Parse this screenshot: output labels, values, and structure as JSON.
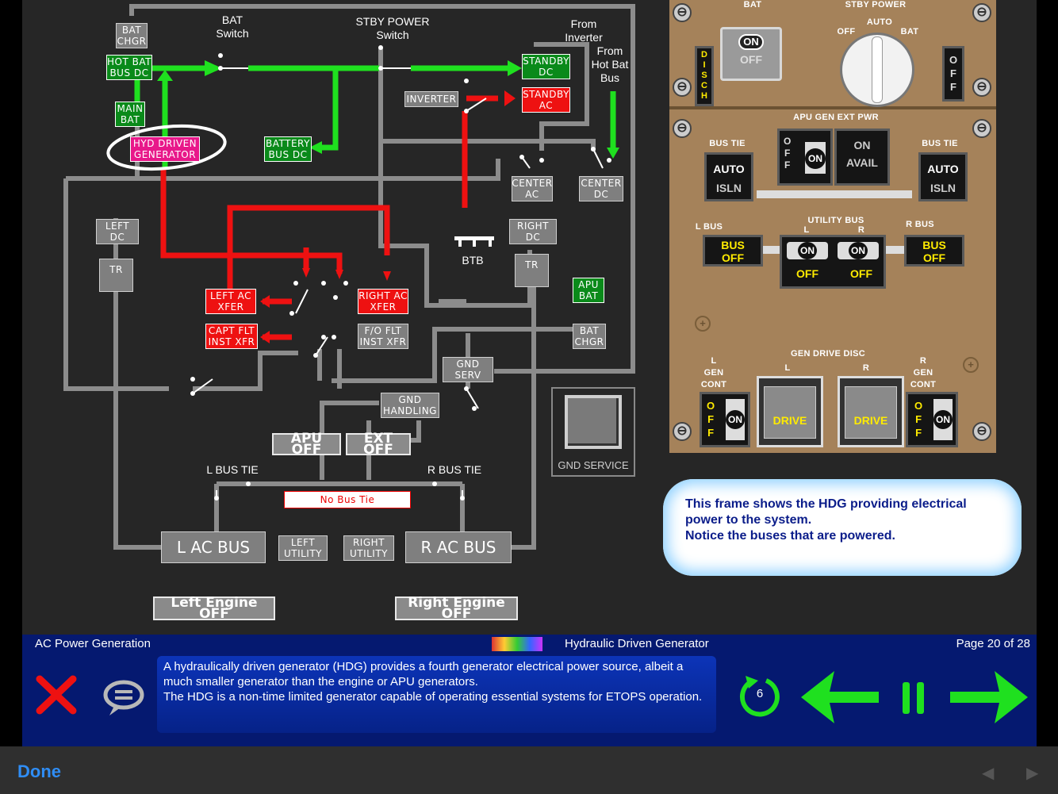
{
  "diagram": {
    "bat_switch_label": "BAT\nSwitch",
    "stby_power_switch_label": "STBY POWER\nSwitch",
    "from_inverter": "From\nInverter",
    "from_hot_bat_bus": "From\nHot Bat\nBus",
    "bat_chgr": "BAT\nCHGR",
    "hot_bat_bus_dc": "HOT BAT\nBUS DC",
    "main_bat": "MAIN\nBAT",
    "hyd_driven_generator": "HYD DRIVEN\nGENERATOR",
    "battery_bus_dc": "BATTERY\nBUS DC",
    "standby_dc": "STANDBY\nDC",
    "standby_ac": "STANDBY\nAC",
    "inverter": "INVERTER",
    "center_ac": "CENTER\nAC",
    "center_dc": "CENTER\nDC",
    "left_dc": "LEFT\nDC",
    "right_dc": "RIGHT\nDC",
    "btb": "BTB",
    "tr_left": "TR",
    "tr_right": "TR",
    "left_ac_xfer": "LEFT AC\nXFER",
    "right_ac_xfer": "RIGHT AC\nXFER",
    "capt_flt_inst_xfr": "CAPT FLT\nINST XFR",
    "fo_flt_inst_xfr": "F/O FLT\nINST XFR",
    "apu_bat": "APU\nBAT",
    "bat_chgr_right": "BAT\nCHGR",
    "gnd_serv": "GND\nSERV",
    "gnd_handling": "GND\nHANDLING",
    "apu_off": "APU OFF",
    "ext_off": "EXT OFF",
    "gnd_service_label": "GND SERVICE",
    "l_bus_tie": "L BUS TIE",
    "r_bus_tie": "R BUS TIE",
    "no_bus_tie": "No Bus Tie",
    "l_ac_bus": "L AC BUS",
    "r_ac_bus": "R AC BUS",
    "left_utility": "LEFT\nUTILITY",
    "right_utility": "RIGHT\nUTILITY",
    "left_engine_off": "Left Engine OFF",
    "right_engine_off": "Right Engine OFF"
  },
  "panel": {
    "bat_label": "BAT",
    "stby_power_label": "STBY POWER",
    "stby_auto": "AUTO",
    "stby_off": "OFF",
    "stby_bat": "BAT",
    "bat_on": "ON",
    "bat_off": "OFF",
    "disch": "D\nI\nS\nC\nH",
    "off_vertical": "O\nF\nF",
    "apu_gen_ext_pwr": "APU GEN EXT PWR",
    "bus_tie_left": "BUS TIE",
    "bus_tie_right": "BUS TIE",
    "auto": "AUTO",
    "isln": "ISLN",
    "apu_off_vertical": "O\nF\nF",
    "apu_on": "ON",
    "ext_on": "ON",
    "ext_avail": "AVAIL",
    "utility_bus": "UTILITY BUS",
    "l": "L",
    "r": "R",
    "l_bus": "L BUS",
    "r_bus": "R BUS",
    "bus_off": "BUS\nOFF",
    "util_on": "ON",
    "util_off": "OFF",
    "gen_drive_disc": "GEN DRIVE DISC",
    "l_gen_cont": "L\nGEN\nCONT",
    "r_gen_cont": "R\nGEN\nCONT",
    "drive": "DRIVE",
    "gen_on": "ON"
  },
  "bubble": {
    "text_1": "This frame shows the HDG providing electrical power to the system.",
    "text_2": "Notice the buses that are powered."
  },
  "footer": {
    "lesson_title": "AC Power Generation",
    "frame_title": "Hydraulic Driven Generator",
    "page": "Page 20 of 28",
    "description_1": "A hydraulically driven generator (HDG) provides a fourth generator electrical power source, albeit a much smaller generator than the engine or APU generators.",
    "description_2": "The HDG is a non-time limited generator capable of operating essential systems for ETOPS operation.",
    "replay_count": "6"
  },
  "ios": {
    "done": "Done",
    "prev_arrow": "◀",
    "next_arrow": "▶"
  },
  "colors": {
    "powered_dc": "#1fe01f",
    "powered_ac": "#ee1111",
    "unpowered": "#8c8c8c",
    "panel": "#a5825a",
    "footer": "#051970",
    "annunciator": "#ffeb00"
  }
}
